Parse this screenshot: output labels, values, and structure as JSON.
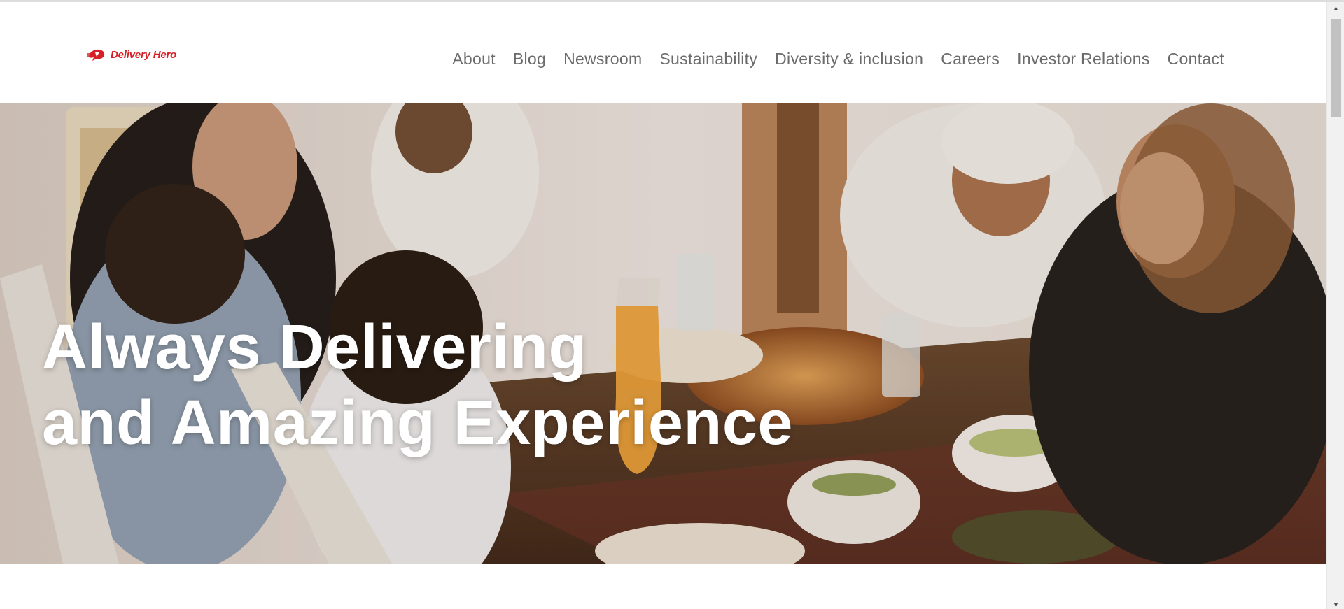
{
  "brand": {
    "name": "Delivery Hero",
    "color": "#d61f26"
  },
  "nav": {
    "items": [
      {
        "label": "About"
      },
      {
        "label": "Blog"
      },
      {
        "label": "Newsroom"
      },
      {
        "label": "Sustainability"
      },
      {
        "label": "Diversity & inclusion"
      },
      {
        "label": "Careers"
      },
      {
        "label": "Investor Relations"
      },
      {
        "label": "Contact"
      }
    ]
  },
  "hero": {
    "line1": "Always Delivering",
    "line2": "and Amazing Experience",
    "image": "family-dinner-photo"
  },
  "scrollbar": {
    "up_icon": "arrow-up-icon",
    "down_icon": "arrow-down-icon"
  }
}
